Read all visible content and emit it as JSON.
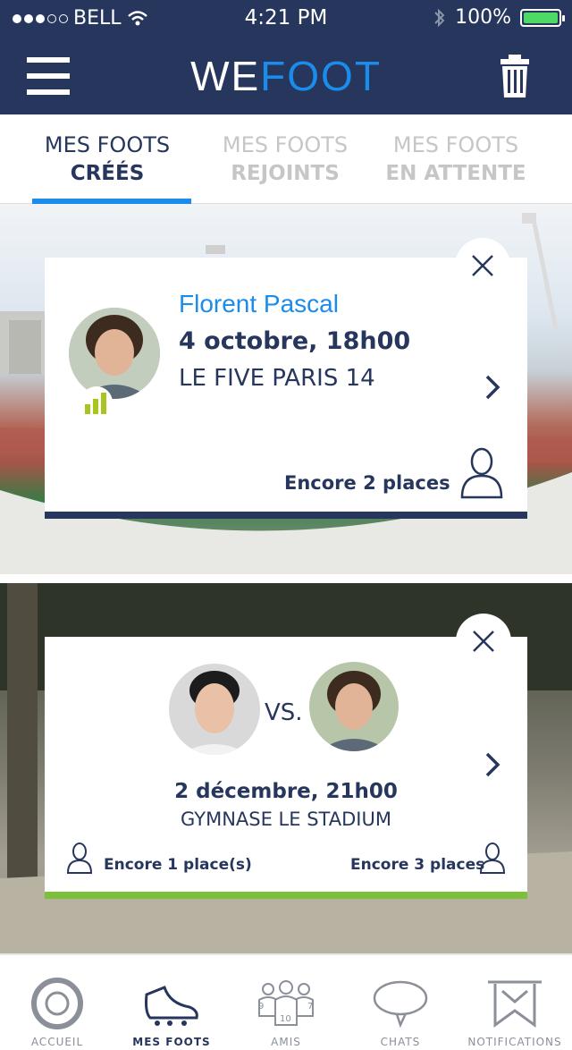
{
  "status_bar": {
    "carrier": "BELL",
    "time": "4:21 PM",
    "battery": "100%"
  },
  "header": {
    "logo_we": "WE",
    "logo_foot": "FOOT"
  },
  "tabs": [
    {
      "line1": "MES FOOTS",
      "line2": "CRÉÉS",
      "active": true
    },
    {
      "line1": "MES FOOTS",
      "line2": "REJOINTS",
      "active": false
    },
    {
      "line1": "MES FOOTS",
      "line2": "EN ATTENTE",
      "active": false
    }
  ],
  "cards": [
    {
      "organizer": "Florent Pascal",
      "datetime": "4 octobre, 18h00",
      "venue": "LE FIVE PARIS 14",
      "places": "Encore 2 places"
    },
    {
      "vs_label": "VS.",
      "datetime": "2 décembre, 21h00",
      "venue": "GYMNASE LE STADIUM",
      "places_left": "Encore 1 place(s)",
      "places_right": "Encore 3 places"
    }
  ],
  "bottom_nav": [
    {
      "label": "ACCUEIL",
      "icon": "home-logo-icon",
      "active": false
    },
    {
      "label": "MES FOOTS",
      "icon": "football-boot-icon",
      "active": true
    },
    {
      "label": "AMIS",
      "icon": "friends-jersey-icon",
      "active": false,
      "numbers": [
        "9",
        "10",
        "7"
      ]
    },
    {
      "label": "CHATS",
      "icon": "chat-bubble-icon",
      "active": false
    },
    {
      "label": "NOTIFICATIONS",
      "icon": "bookmark-notification-icon",
      "active": false
    }
  ],
  "colors": {
    "navy": "#26365c",
    "accent_blue": "#1a8ceb",
    "green": "#7cbf3a"
  }
}
